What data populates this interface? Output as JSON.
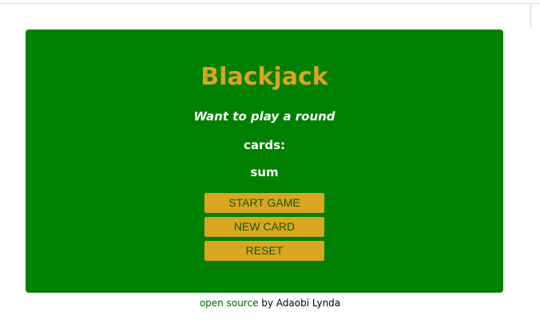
{
  "game": {
    "title": "Blackjack",
    "message": "Want to play a round",
    "cards_label": "cards:",
    "sum_label": "sum",
    "buttons": {
      "start": "START GAME",
      "new_card": "NEW CARD",
      "reset": "RESET"
    }
  },
  "footer": {
    "link_text": "open source",
    "byline": " by Adaobi Lynda"
  },
  "colors": {
    "panel_background": "#008000",
    "title": "#daa520",
    "button_background": "#daa520",
    "button_text": "#0f5d0f",
    "link": "#006400"
  }
}
